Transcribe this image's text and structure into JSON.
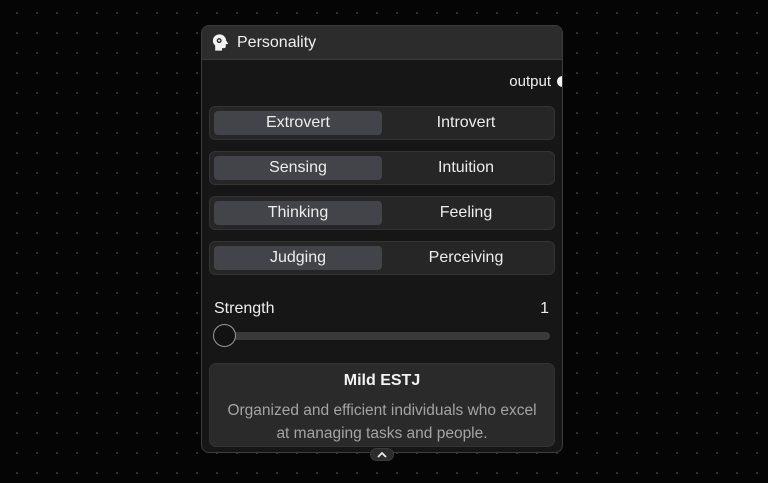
{
  "node": {
    "title": "Personality",
    "icon": "head-profile-icon",
    "output_label": "output",
    "toggles": [
      {
        "left": "Extrovert",
        "right": "Introvert",
        "selected": "left"
      },
      {
        "left": "Sensing",
        "right": "Intuition",
        "selected": "left"
      },
      {
        "left": "Thinking",
        "right": "Feeling",
        "selected": "left"
      },
      {
        "left": "Judging",
        "right": "Perceiving",
        "selected": "left"
      }
    ],
    "strength": {
      "label": "Strength",
      "value": "1",
      "fraction": 0
    },
    "description": {
      "title": "Mild ESTJ",
      "text": "Organized and efficient individuals who excel at managing tasks and people."
    }
  },
  "colors": {
    "background": "#050505",
    "node_body": "#161616",
    "node_header": "#2c2c2c",
    "toggle_active": "#43434a",
    "text": "#ececec",
    "muted_text": "#a4a4a4"
  }
}
